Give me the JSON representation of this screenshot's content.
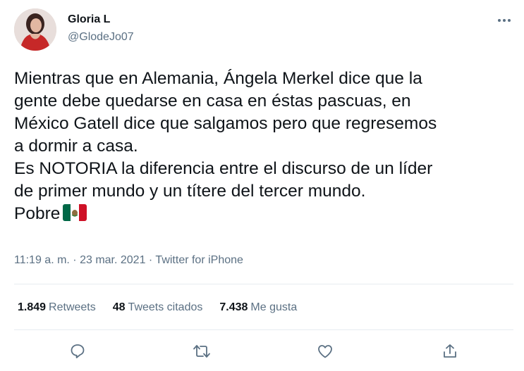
{
  "author": {
    "name": "Gloria L",
    "handle": "@GlodeJo07"
  },
  "tweet": {
    "lines": [
      "Mientras que en Alemania, Ángela Merkel dice que la",
      "gente debe quedarse en casa en éstas pascuas, en",
      "México Gatell dice que salgamos pero que regresemos",
      "a dormir a casa.",
      "Es NOTORIA la diferencia entre el discurso de un líder",
      "de primer mundo y un títere del tercer mundo.",
      "Pobre"
    ],
    "emoji": "mexico-flag"
  },
  "meta": {
    "time": "11:19 a. m.",
    "sep1": " · ",
    "date": "23 mar. 2021",
    "sep2": " · ",
    "source": "Twitter for iPhone"
  },
  "stats": {
    "retweets_count": "1.849",
    "retweets_label": "Retweets",
    "quotes_count": "48",
    "quotes_label": "Tweets citados",
    "likes_count": "7.438",
    "likes_label": "Me gusta"
  },
  "icons": {
    "more": "more-icon",
    "reply": "reply-icon",
    "retweet": "retweet-icon",
    "like": "like-icon",
    "share": "share-icon"
  },
  "colors": {
    "text": "#0f1419",
    "secondary": "#5b7083",
    "divider": "#e6ecf0",
    "icon": "#5b7083"
  }
}
